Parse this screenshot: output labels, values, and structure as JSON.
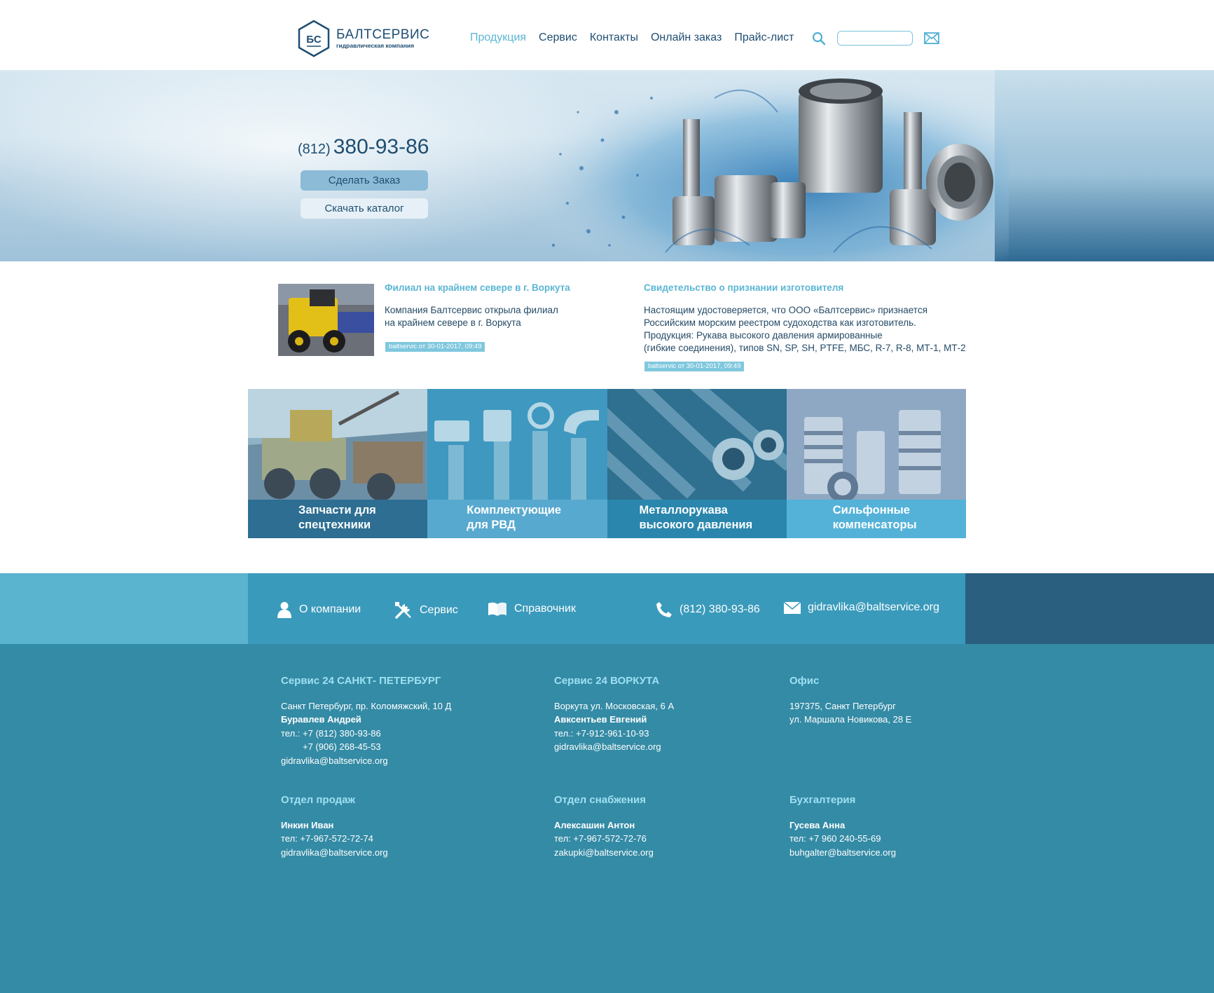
{
  "header": {
    "logo_name": "БАЛТСЕРВИС",
    "logo_tagline": "гидравлическая компания",
    "logo_monogram": "БС",
    "nav": [
      {
        "label": "Продукция",
        "active": true
      },
      {
        "label": "Сервис",
        "active": false
      },
      {
        "label": "Контакты",
        "active": false
      },
      {
        "label": "Онлайн заказ",
        "active": false
      },
      {
        "label": "Прайс-лист",
        "active": false
      }
    ],
    "search_value": "",
    "icons": {
      "search": "search-icon",
      "mail": "mail-icon"
    }
  },
  "hero": {
    "phone_code": "(812)",
    "phone_number": "380-93-86",
    "order_button": "Сделать Заказ",
    "catalog_button": "Скачать каталог"
  },
  "news": [
    {
      "title": "Филиал на крайнем севере в г. Воркута",
      "lines": [
        "Компания Балтсервис открыла филиал",
        "на крайнем севере в г. Воркута"
      ],
      "date": "baltservic от 30-01-2017, 09:49"
    },
    {
      "title": "Свидетельство о признании изготовителя",
      "lines": [
        "Настоящим удостоверяется, что ООО «Балтсервис» признается",
        "Российским морским реестром судоходства как изготовитель.",
        "Продукция: Рукава высокого давления армированные",
        "(гибкие соединения), типов SN, SP, SH, PTFE, МБС, R-7, R-8, МТ-1, МТ-2"
      ],
      "date": "baltservic от 30-01-2017, 09:49"
    }
  ],
  "categories": [
    {
      "line1": "Запчасти для",
      "line2": "спецтехники",
      "band_color": "#2d6e92"
    },
    {
      "line1": "Комплектующие",
      "line2": "для РВД",
      "band_color": "#58a9cf"
    },
    {
      "line1": "Металлорукава",
      "line2": "высокого давления",
      "band_color": "#2a86ad"
    },
    {
      "line1": "Сильфонные",
      "line2": "компенсаторы",
      "band_color": "#54b2d8"
    }
  ],
  "footer_bar": {
    "about": "О компании",
    "service": "Сервис",
    "reference": "Справочник",
    "phone": "(812) 380-93-86",
    "email": "gidravlika@baltservice.org"
  },
  "footer": {
    "spb": {
      "title": "Сервис 24 САНКТ- ПЕТЕРБУРГ",
      "address": "Санкт Петербург, пр. Коломяжский, 10 Д",
      "person": "Буравлев Андрей",
      "phone1": "тел.: +7 (812) 380-93-86",
      "phone2": "+7 (906) 268-45-53",
      "email": "gidravlika@baltservice.org"
    },
    "vorkuta": {
      "title": "Сервис 24 ВОРКУТА",
      "address": "Воркута ул. Московская, 6 А",
      "person": "Авксентьев Евгений",
      "phone": "тел.: +7-912-961-10-93",
      "email": "gidravlika@baltservice.org"
    },
    "office": {
      "title": "Офис",
      "line1": "197375, Санкт Петербург",
      "line2": "ул. Маршала Новикова, 28 Е"
    },
    "sales": {
      "title": "Отдел продаж",
      "person": "Инкин Иван",
      "phone": "тел: +7-967-572-72-74",
      "email": "gidravlika@baltservice.org"
    },
    "supply": {
      "title": "Отдел снабжения",
      "person": "Алексашин Антон",
      "phone": "тел: +7-967-572-72-76",
      "email": "zakupki@baltservice.org"
    },
    "accounting": {
      "title": "Бухгалтерия",
      "person": "Гусева Анна",
      "phone": "тел: +7 960 240-55-69",
      "email": "buhgalter@baltservice.org"
    }
  }
}
